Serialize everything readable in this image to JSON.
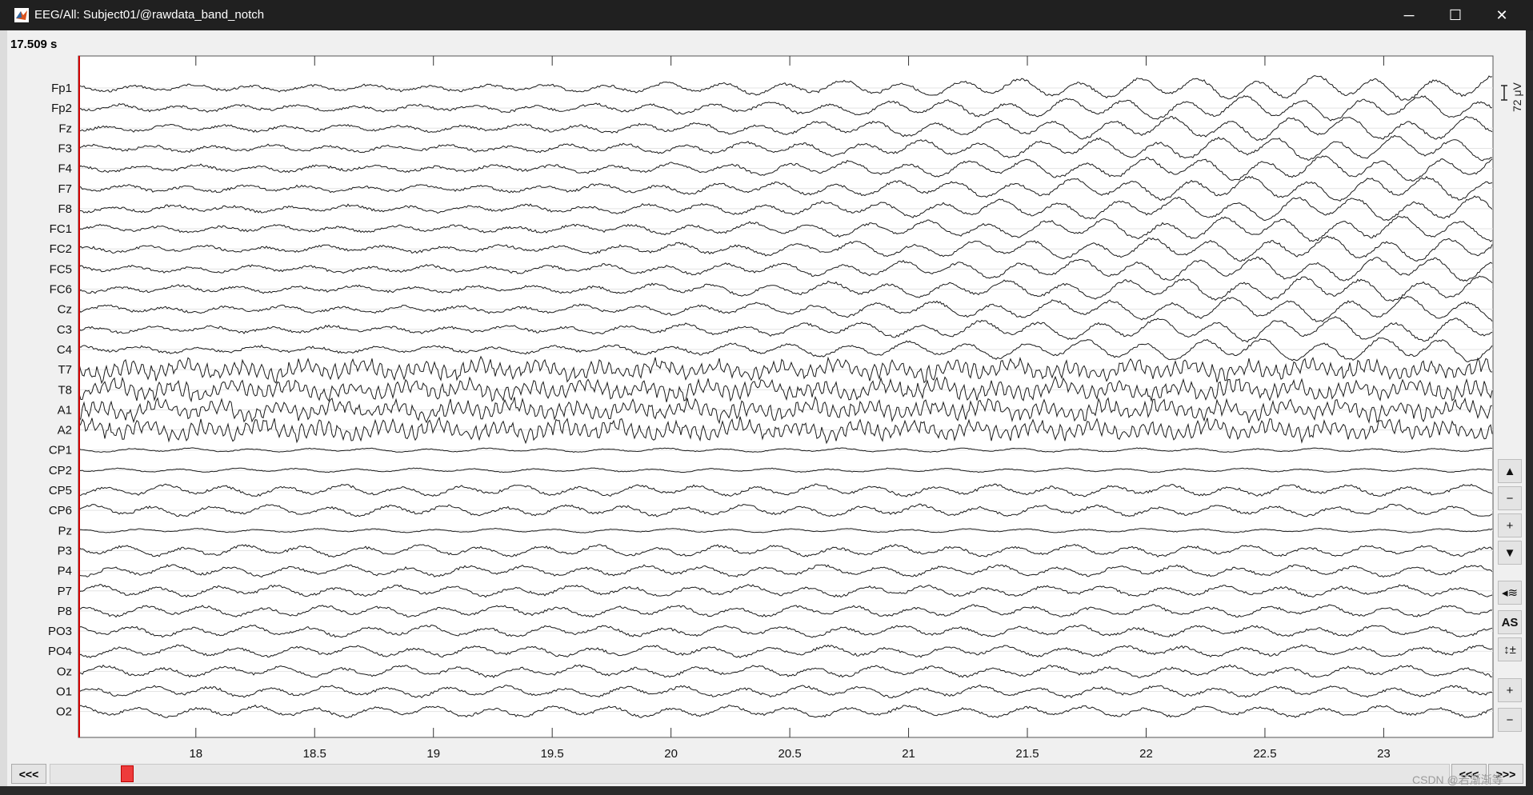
{
  "window": {
    "title": "EEG/All: Subject01/@rawdata_band_notch",
    "controls": {
      "minimize": "─",
      "maximize": "☐",
      "close": "✕"
    }
  },
  "time_readout": "17.509 s",
  "scale_label": "72 μV",
  "channels": [
    "Fp1",
    "Fp2",
    "Fz",
    "F3",
    "F4",
    "F7",
    "F8",
    "FC1",
    "FC2",
    "FC5",
    "FC6",
    "Cz",
    "C3",
    "C4",
    "T7",
    "T8",
    "A1",
    "A2",
    "CP1",
    "CP2",
    "CP5",
    "CP6",
    "Pz",
    "P3",
    "P4",
    "P7",
    "P8",
    "PO3",
    "PO4",
    "Oz",
    "O1",
    "O2"
  ],
  "x_axis": {
    "ticks": [
      "18",
      "18.5",
      "19",
      "19.5",
      "20",
      "20.5",
      "21",
      "21.5",
      "22",
      "22.5",
      "23"
    ],
    "range": [
      17.509,
      23.46
    ]
  },
  "side_controls": [
    {
      "name": "scroll-up-button",
      "icon": "triangle-up-icon",
      "label": "▲"
    },
    {
      "name": "zoom-out-button",
      "icon": "zoom-out-icon",
      "label": "−"
    },
    {
      "name": "zoom-in-button",
      "icon": "zoom-in-icon",
      "label": "+"
    },
    {
      "name": "scroll-down-button",
      "icon": "triangle-down-icon",
      "label": "▼"
    },
    {
      "name": "toggle-display-button",
      "icon": "wave-icon",
      "label": "◂≋"
    },
    {
      "name": "autoscale-button",
      "icon": "",
      "label": "AS"
    },
    {
      "name": "montage-button",
      "icon": "arrows-updown-icon",
      "label": "↕±"
    },
    {
      "name": "gain-increase-button",
      "icon": "plus-icon",
      "label": "+"
    },
    {
      "name": "gain-decrease-button",
      "icon": "minus-icon",
      "label": "−"
    }
  ],
  "navigation": {
    "prev_page": "<<<",
    "prev_page_right": "<<<",
    "next_page_right": ">>>"
  },
  "scrollbar": {
    "position_fraction": 0.03
  },
  "watermark": "CSDN @若渐渐等",
  "colors": {
    "titlebar": "#202020",
    "trace": "#1a1a1a",
    "cursor": "#d40000",
    "scroll_thumb": "#ee3b3b"
  }
}
